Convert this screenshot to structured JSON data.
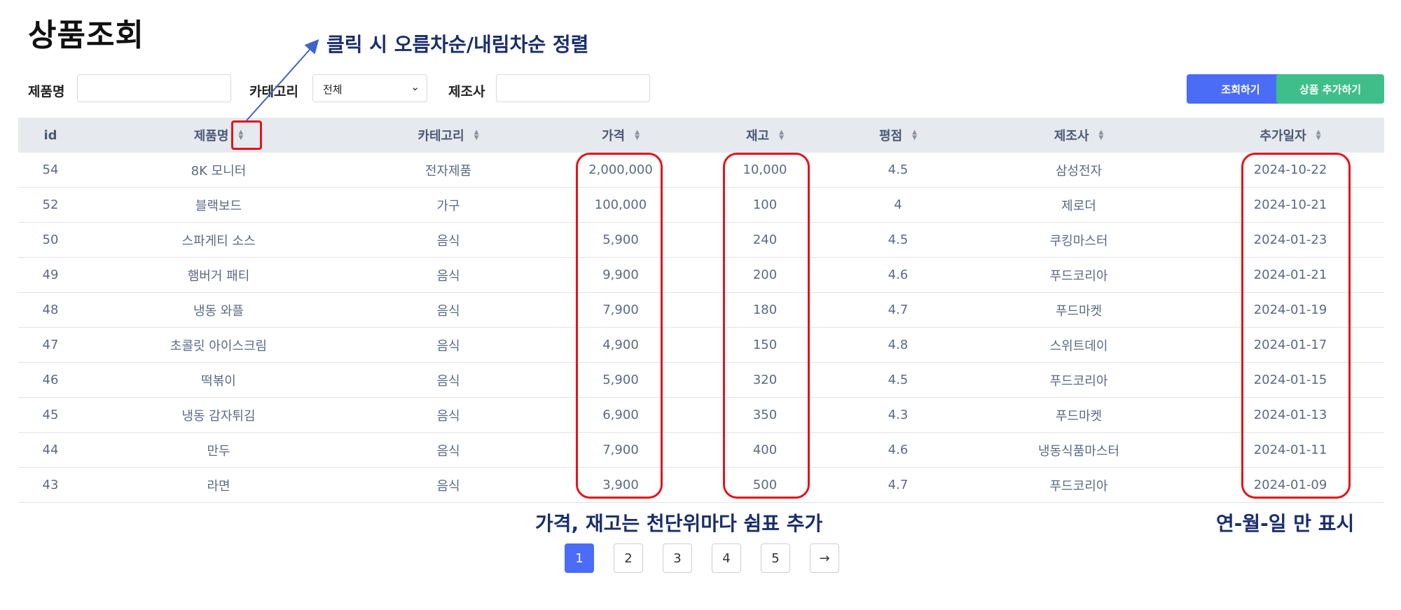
{
  "page": {
    "title": "상품조회"
  },
  "filters": {
    "product_name_label": "제품명",
    "product_name_value": "",
    "category_label": "카테고리",
    "category_selected": "전체",
    "manufacturer_label": "제조사",
    "manufacturer_value": ""
  },
  "buttons": {
    "search": "조회하기",
    "add_product": "상품 추가하기"
  },
  "table": {
    "columns": [
      {
        "key": "id",
        "label": "id",
        "sortable": false
      },
      {
        "key": "name",
        "label": "제품명",
        "sortable": true
      },
      {
        "key": "category",
        "label": "카테고리",
        "sortable": true
      },
      {
        "key": "price",
        "label": "가격",
        "sortable": true
      },
      {
        "key": "stock",
        "label": "재고",
        "sortable": true
      },
      {
        "key": "rating",
        "label": "평점",
        "sortable": true
      },
      {
        "key": "manufacturer",
        "label": "제조사",
        "sortable": true
      },
      {
        "key": "date",
        "label": "추가일자",
        "sortable": true
      }
    ],
    "rows": [
      [
        "54",
        "8K 모니터",
        "전자제품",
        "2,000,000",
        "10,000",
        "4.5",
        "삼성전자",
        "2024-10-22"
      ],
      [
        "52",
        "블랙보드",
        "가구",
        "100,000",
        "100",
        "4",
        "제로더",
        "2024-10-21"
      ],
      [
        "50",
        "스파게티 소스",
        "음식",
        "5,900",
        "240",
        "4.5",
        "쿠킹마스터",
        "2024-01-23"
      ],
      [
        "49",
        "햄버거 패티",
        "음식",
        "9,900",
        "200",
        "4.6",
        "푸드코리아",
        "2024-01-21"
      ],
      [
        "48",
        "냉동 와플",
        "음식",
        "7,900",
        "180",
        "4.7",
        "푸드마켓",
        "2024-01-19"
      ],
      [
        "47",
        "초콜릿 아이스크림",
        "음식",
        "4,900",
        "150",
        "4.8",
        "스위트데이",
        "2024-01-17"
      ],
      [
        "46",
        "떡볶이",
        "음식",
        "5,900",
        "320",
        "4.5",
        "푸드코리아",
        "2024-01-15"
      ],
      [
        "45",
        "냉동 감자튀김",
        "음식",
        "6,900",
        "350",
        "4.3",
        "푸드마켓",
        "2024-01-13"
      ],
      [
        "44",
        "만두",
        "음식",
        "7,900",
        "400",
        "4.6",
        "냉동식품마스터",
        "2024-01-11"
      ],
      [
        "43",
        "라면",
        "음식",
        "3,900",
        "500",
        "4.7",
        "푸드코리아",
        "2024-01-09"
      ]
    ]
  },
  "pagination": {
    "pages": [
      "1",
      "2",
      "3",
      "4",
      "5"
    ],
    "active": "1",
    "next": "→"
  },
  "annotations": {
    "sort_note": "클릭 시 오름차순/내림차순 정렬",
    "comma_note": "가격, 재고는 천단위마다 쉼표 추가",
    "date_note": "연-월-일 만 표시",
    "color": "#e3141b"
  }
}
